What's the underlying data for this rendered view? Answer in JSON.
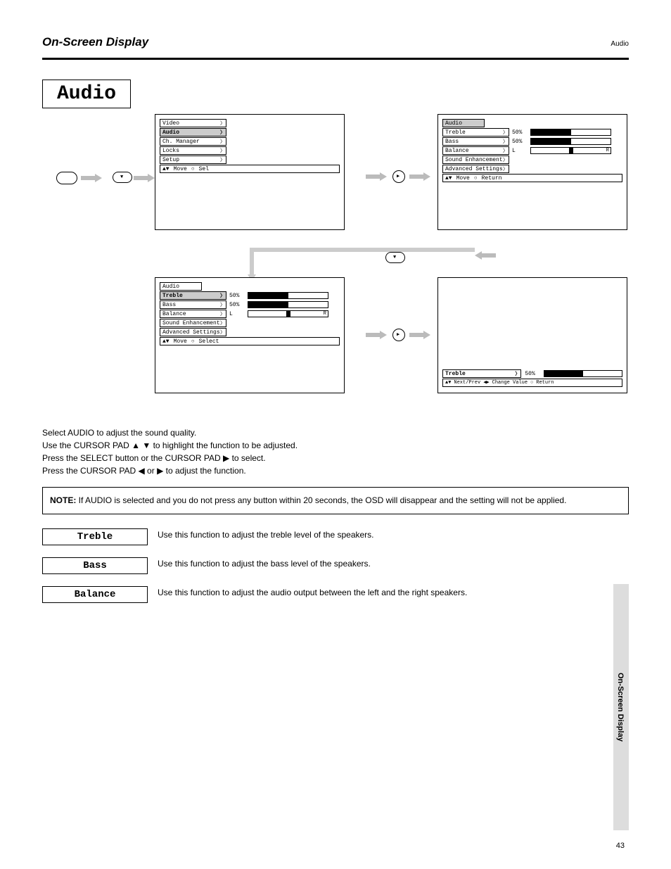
{
  "header": {
    "left": "On-Screen Display",
    "right": "Audio"
  },
  "title": "Audio",
  "screens": {
    "s1": {
      "crumb": "Video",
      "items": [
        "Video",
        "Audio",
        "Ch. Manager",
        "Locks",
        "Setup"
      ],
      "selected": 1,
      "footer": {
        "sym1": "▲▼",
        "lbl1": "Move",
        "sym2": "○",
        "lbl2": "Sel"
      }
    },
    "s2": {
      "crumb": "Audio",
      "items": [
        "Treble",
        "Bass",
        "Balance",
        "Sound Enhancement",
        "Advanced Settings"
      ],
      "vals": [
        "50%",
        "50%",
        ""
      ],
      "footer": {
        "sym1": "▲▼",
        "lbl1": "Move",
        "sym2": "○",
        "lbl2": "Return"
      }
    },
    "s3": {
      "crumb": "Audio",
      "items": [
        "Treble",
        "Bass",
        "Balance",
        "Sound Enhancement",
        "Advanced Settings"
      ],
      "selected": 0,
      "vals": [
        "50%",
        "50%",
        ""
      ],
      "footer": {
        "sym1": "▲▼",
        "lbl1": "Move",
        "sym2": "○",
        "lbl2": "Select"
      }
    },
    "s4": {
      "item": "Treble",
      "val": "50%",
      "footer": {
        "sym1": "▲▼",
        "lbl1": "Next/Prev",
        "sym2": "◀▶",
        "lbl2": "Change Value",
        "sym3": "○",
        "lbl3": "Return"
      }
    }
  },
  "body": {
    "line1": "Select AUDIO to adjust the sound quality.",
    "line2a": "Use the CURSOR PAD ",
    "line2b": " to highlight the function to be adjusted.",
    "line3a": "Press the SELECT button or the CURSOR PAD ",
    "line3b": " to select.",
    "line4a": "Press the CURSOR PAD ",
    "line4b": " to adjust the function."
  },
  "note": {
    "label": "NOTE:",
    "text": " If AUDIO is selected and you do not press any button within 20 seconds, the OSD will disappear and the setting will not be applied."
  },
  "sections": {
    "treble": {
      "label": "Treble",
      "desc": "Use this function to adjust the treble level of the speakers."
    },
    "bass": {
      "label": "Bass",
      "desc": "Use this function to adjust the bass level of the speakers."
    },
    "balance": {
      "label": "Balance",
      "desc": "Use this function to adjust the audio output between the left and the right speakers."
    }
  },
  "sideTab": "On-Screen Display",
  "pageNum": "43"
}
